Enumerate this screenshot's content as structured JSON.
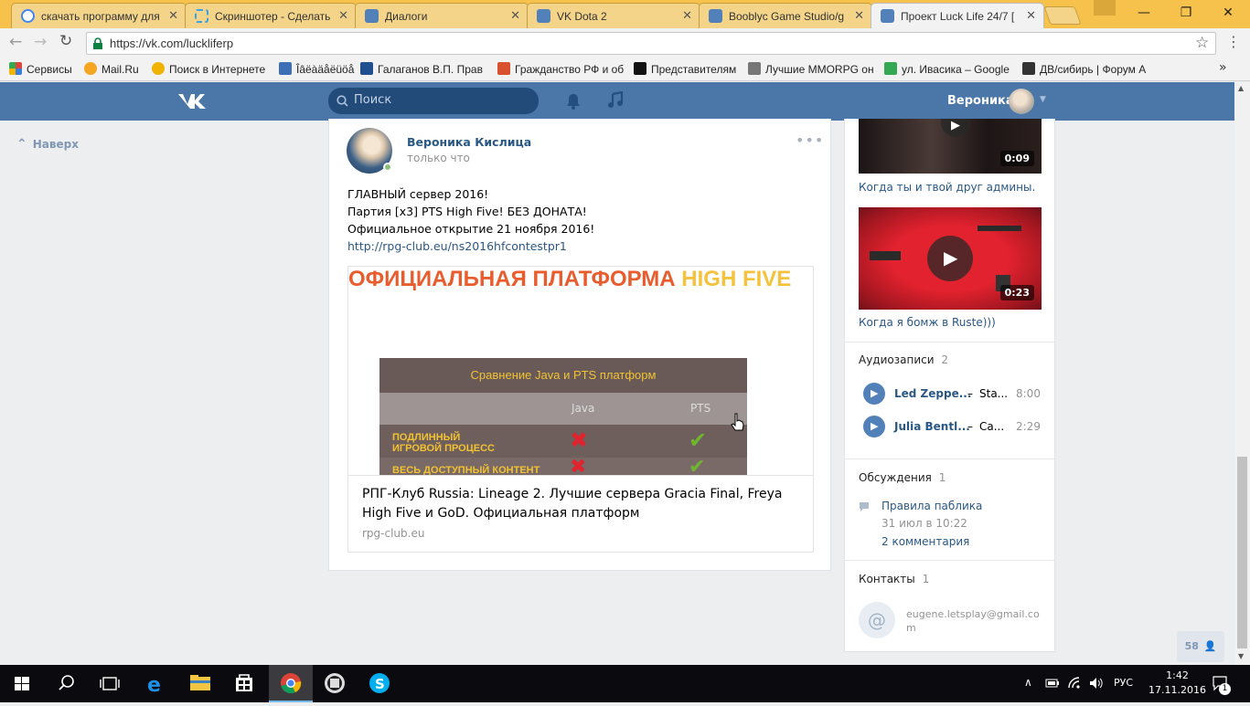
{
  "browser": {
    "tabs": [
      {
        "title": "скачать программу для",
        "favicon": "google-icon",
        "color": "#4285f4"
      },
      {
        "title": "Скриншотер - Сделать",
        "favicon": "screenshot-icon",
        "color": "#3aa0e8"
      },
      {
        "title": "Диалоги",
        "favicon": "vk-icon",
        "color": "#5181b8"
      },
      {
        "title": "VK Dota 2",
        "favicon": "vk-icon",
        "color": "#5181b8"
      },
      {
        "title": "Booblyc Game Studio/g",
        "favicon": "vk-icon",
        "color": "#5181b8"
      },
      {
        "title": "Проект Luck Life 24/7 [",
        "favicon": "vk-icon",
        "color": "#5181b8"
      }
    ],
    "url": "https://vk.com/luckliferp",
    "bookmarks": [
      {
        "label": "Сервисы",
        "icon": "apps-icon",
        "color": "#e0453a"
      },
      {
        "label": "Mail.Ru",
        "icon": "mailru-icon",
        "color": "#f5a623"
      },
      {
        "label": "Поиск в Интернете",
        "icon": "search-icon",
        "color": "#f0b400"
      },
      {
        "label": "Îâëàäåëüöå",
        "icon": "pen-icon",
        "color": "#3d6fb6"
      },
      {
        "label": "Галаганов В.П. Прав",
        "icon": "t-icon",
        "color": "#1f4f8f"
      },
      {
        "label": "Гражданство РФ и об",
        "icon": "flag-icon",
        "color": "#d9502e"
      },
      {
        "label": "Представителям",
        "icon": "a-icon",
        "color": "#111111"
      },
      {
        "label": "Лучшие MMORPG он",
        "icon": "gun-icon",
        "color": "#666666"
      },
      {
        "label": "ул. Ивасика – Google",
        "icon": "maps-icon",
        "color": "#34a853"
      },
      {
        "label": "ДВ/сибирь | Форум А",
        "icon": "forum-icon",
        "color": "#333333"
      }
    ]
  },
  "vk": {
    "search_placeholder": "Поиск",
    "user_name": "Вероника",
    "back_to_top": "Наверх",
    "post": {
      "author": "Вероника Кислица",
      "time": "только что",
      "lines": [
        "ГЛАВНЫЙ сервер 2016!",
        "Партия [x3] PTS High Five! БЕЗ ДОНАТА!",
        "Официальное открытие 21 ноября 2016!"
      ],
      "link": "http://rpg-club.eu/ns2016hfcontestpr1",
      "banner_title_a": "ОФИЦИАЛЬНАЯ ПЛАТФОРМА",
      "banner_title_b": "HIGH FIVE",
      "table_title": "Сравнение Java и PTS платформ",
      "col_java": "Java",
      "col_pts": "PTS",
      "row1": "ПОДЛИННЫЙ\nИГРОВОЙ ПРОЦЕСС",
      "row2": "ВЕСЬ ДОСТУПНЫЙ КОНТЕНТ",
      "link_title": "РПГ-Клуб Russia: Lineage 2. Лучшие сервера Gracia Final, Freya High Five и GoD. Официальная платформ",
      "link_domain": "rpg-club.eu"
    },
    "videos": [
      {
        "duration": "0:09",
        "caption": "Когда ты и твой друг админы."
      },
      {
        "duration": "0:23",
        "caption": "Когда я бомж в Ruste)))"
      }
    ],
    "audio": {
      "title": "Аудиозаписи",
      "count": "2",
      "tracks": [
        {
          "artist": "Led Zeppe...",
          "dash": "–",
          "song": "Sta...",
          "duration": "8:00"
        },
        {
          "artist": "Julia Bentl...",
          "dash": "–",
          "song": "Ca...",
          "duration": "2:29"
        }
      ]
    },
    "discussions": {
      "title": "Обсуждения",
      "count": "1",
      "topic": "Правила паблика",
      "date": "31 июл в 10:22",
      "comments": "2 комментария"
    },
    "contacts": {
      "title": "Контакты",
      "count": "1",
      "email_line1": "eugene.letsplay@gmail.co",
      "email_line2": "m"
    },
    "online_count": "58"
  },
  "taskbar": {
    "lang": "РУС",
    "time": "1:42",
    "date": "17.11.2016",
    "notifications": "1"
  }
}
